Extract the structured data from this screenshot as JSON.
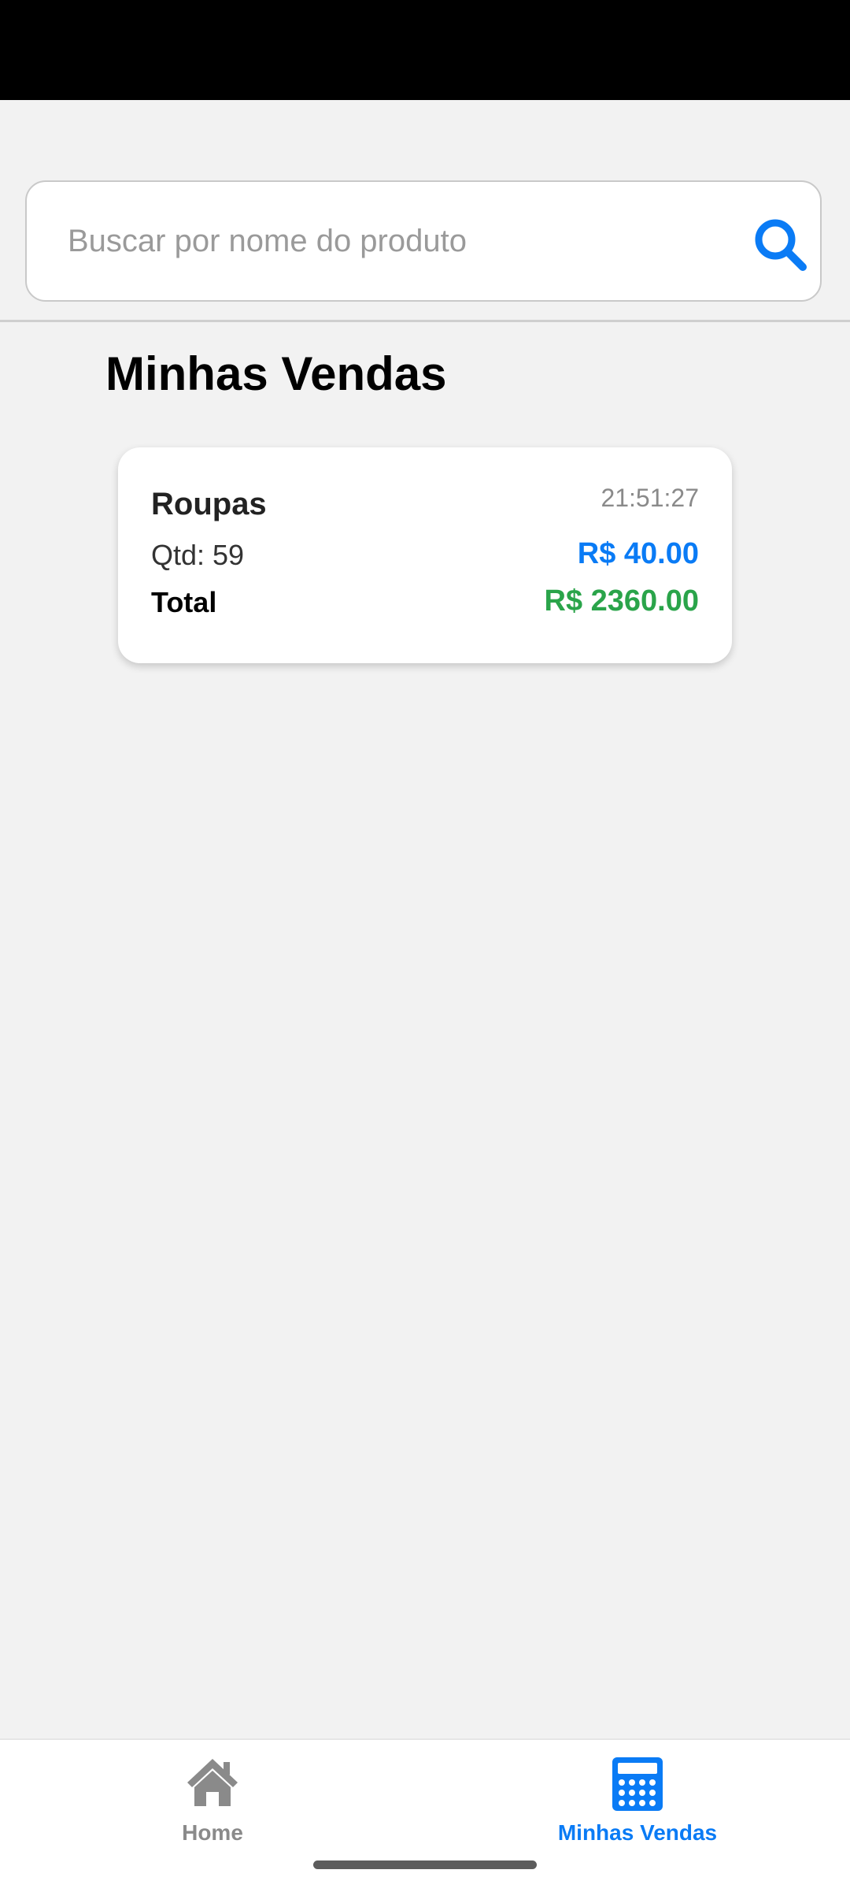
{
  "search": {
    "placeholder": "Buscar por nome do produto",
    "value": "",
    "icon": "search-icon"
  },
  "page": {
    "title": "Minhas Vendas"
  },
  "sales": [
    {
      "product": "Roupas",
      "time": "21:51:27",
      "quantity_label": "Qtd: 59",
      "unit_price": "R$ 40.00",
      "total_label": "Total",
      "total_value": "R$ 2360.00"
    }
  ],
  "nav": {
    "items": [
      {
        "label": "Home",
        "icon": "home-icon",
        "active": false
      },
      {
        "label": "Minhas Vendas",
        "icon": "calculator-icon",
        "active": true
      }
    ]
  },
  "colors": {
    "accent": "#0a7bf5",
    "total_green": "#2aa44a",
    "inactive_gray": "#8a8a8a",
    "background": "#f2f2f2",
    "status_bar": "#000000"
  }
}
